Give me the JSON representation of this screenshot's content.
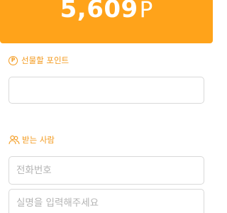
{
  "header": {
    "points_value": "5,609",
    "points_unit": "P"
  },
  "gift_points": {
    "icon_letter": "P",
    "label": "선물할 포인트",
    "input_value": "",
    "input_placeholder": ""
  },
  "recipient": {
    "icon": "people-icon",
    "label": "받는 사람",
    "phone_placeholder": "전화번호",
    "name_placeholder": "실명을 입력해주세요"
  },
  "colors": {
    "accent": "#FFA31A",
    "label": "#F39A1E",
    "border": "#d9d9d9",
    "placeholder": "#b3b3b3"
  }
}
